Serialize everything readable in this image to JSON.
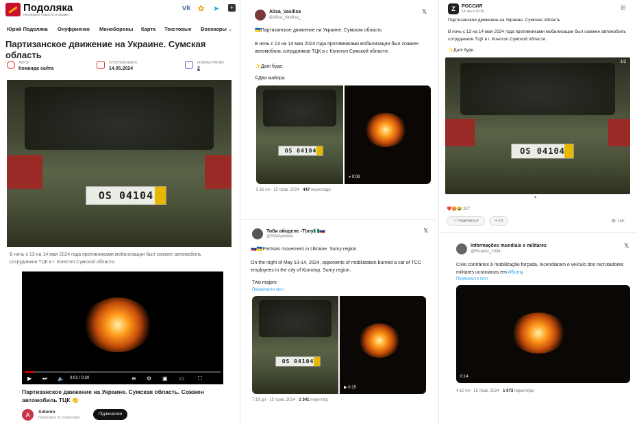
{
  "site": {
    "logo_text": "Подоляка",
    "logo_sub": "последние новости и сводки",
    "social_icons": [
      "vk-icon",
      "ok-icon",
      "telegram-icon",
      "plus-icon"
    ],
    "nav": [
      "Юрий Подоляка",
      "Онуфриенко",
      "Минобороны",
      "Карта",
      "Текстовые",
      "Военкоры"
    ],
    "article_title": "Партизанское движение на Украине. Сумская область",
    "meta": {
      "author_label": "АВТОР",
      "author_value": "Команда сайта",
      "date_label": "ОПУБЛИКОВАНО",
      "date_value": "14.05.2024",
      "comments_label": "КОММЕНТАРИИ",
      "comments_value": "2"
    },
    "photo_plate": "OS 04104",
    "caption": "В ночь с 13 на 14 мая 2024 года противниками мобилизации был сожжен автомобиль сотрудников ТЦК в г. Конотоп Сумской области.",
    "video": {
      "time": "0:01 / 0:20",
      "progress": 0.05,
      "title": "Партизанское движение на Украине. Сумская область. Сожжен автомобиль ТЦК 👏",
      "channel": "Antonio",
      "channel_initial": "A",
      "subscribers": "Підписався 21 користувач",
      "subscribe_label": "Підписатися"
    }
  },
  "tweet1": {
    "name": "Alisa_Vasilisa",
    "handle": "@Alisa_Vasilisa_",
    "line1": "🇺🇦Партизанское движение на Украине. Сумская область",
    "line2": "В ночь с 13 на 14 мая 2024 года противниками мобилизации был сожжен автомобиль сотрудников ТЦК в г. Конотоп Сумской области.",
    "line3": "✨Далі буде.",
    "line4": "©Два майора",
    "plate": "OS 04104",
    "duration": "0:08",
    "time": "5:16 пп · 15 трав. 2024 ·",
    "views": "447",
    "views_label": "перегляди"
  },
  "tweet2": {
    "name": "Тоби айоделе -Tboy🇳🇬🇷🇺",
    "handle": "@TobiAyodele",
    "line1": "🇷🇺🇺🇦Partisan movement in Ukraine. Sumy region",
    "line2": "On the night of May 13-14, 2024, opponents of mobilization burned a car of TCC employees in the city of Konotop, Sumy region.",
    "line3": "Two majors",
    "translate": "Перекласти пост",
    "plate": "OS 04104",
    "duration": "0:15",
    "time": "7:19 дп · 15 трав. 2024 ·",
    "views": "1 341",
    "views_label": "перегляд"
  },
  "tg": {
    "name": "РОССИЯ",
    "handle": "14 тра в 16:36",
    "line1": "Партизанское движение на Украине. Сумская область",
    "line2": "В ночь с 13 на 14 мая 2024 года противниками мобилизации был сожжен автомобиль сотрудников ТЦК в г. Конотоп Сумской области.",
    "line3": "✨Далі буде.",
    "counter": "1/2",
    "plate": "OS 04104",
    "reactions": "❤️😡😂",
    "reaction_count": "337",
    "share_label": "Поделиться",
    "reposts": "13",
    "views": "14K"
  },
  "tweet3": {
    "name": "Informações mundiais e militares",
    "handle": "@Ricardo_1934",
    "text_a": "Civis contrários à mobilização forçada, incendiaram o veículo dos recrutadores militares ucranianos em ",
    "text_link": "#Sumy",
    "text_b": ".",
    "translate": "Перекласти пост",
    "duration": "0:14",
    "time": "4:10 пп · 15 трав. 2024 ·",
    "views": "1 073",
    "views_label": "перегляди"
  }
}
